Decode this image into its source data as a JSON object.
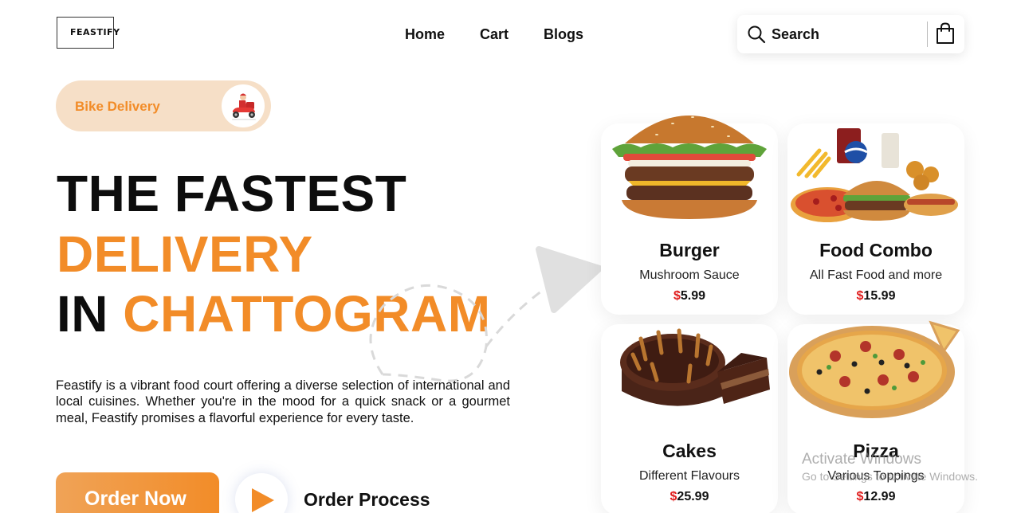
{
  "header": {
    "logo_text": "FEASTIFY",
    "nav": [
      "Home",
      "Cart",
      "Blogs"
    ],
    "search_label": "Search"
  },
  "hero": {
    "badge_label": "Bike Delivery",
    "headline_line1": "THE FASTEST",
    "headline_line2": "DELIVERY",
    "headline_line3_prefix": "IN",
    "headline_line3_highlight": "CHATTOGRAM",
    "description": "Feastify is a vibrant food court offering a diverse selection of international and local cuisines. Whether you're in the mood for a quick snack or a gourmet meal, Feastify promises a flavorful experience for every taste.",
    "order_button": "Order Now",
    "order_process": "Order Process"
  },
  "cards": [
    {
      "name": "Burger",
      "sub": "Mushroom Sauce",
      "currency": "$",
      "price": "5.99",
      "icon": "burger-image"
    },
    {
      "name": "Food Combo",
      "sub": "All Fast Food and more",
      "currency": "$",
      "price": "15.99",
      "icon": "food-combo-image"
    },
    {
      "name": "Cakes",
      "sub": "Different Flavours",
      "currency": "$",
      "price": "25.99",
      "icon": "cake-image"
    },
    {
      "name": "Pizza",
      "sub": "Various Toppings",
      "currency": "$",
      "price": "12.99",
      "icon": "pizza-image"
    }
  ],
  "watermark": {
    "line1": "Activate Windows",
    "line2": "Go to Settings to activate Windows."
  },
  "colors": {
    "accent": "#f28c28",
    "badge_bg": "#f6dfc7",
    "price_currency": "#e01d1d"
  }
}
